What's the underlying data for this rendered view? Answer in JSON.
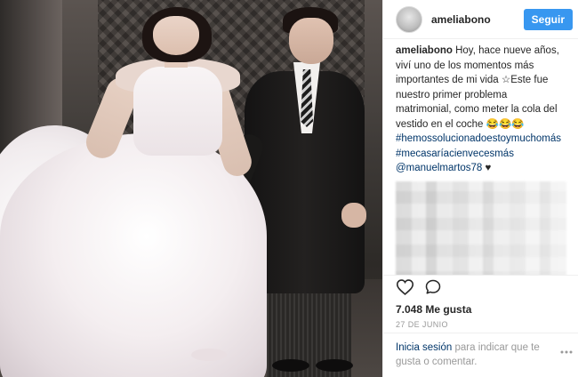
{
  "post": {
    "author": {
      "username": "ameliabono",
      "follow_label": "Seguir"
    },
    "caption": {
      "username": "ameliabono",
      "text": "Hoy, hace nueve años, viví uno de los momentos más importantes de mi vida ☆Este fue nuestro primer problema matrimonial, como meter la cola del vestido en el coche 😂😂😂",
      "hashtags": [
        "#hemossolucionadoestoymuchomás",
        "#mecasaríacienvecesmás"
      ],
      "mention": "@manuelmartos78",
      "mention_suffix": " ♥"
    },
    "actions": {
      "like_icon": "heart-outline-icon",
      "comment_icon": "comment-bubble-icon"
    },
    "likes_text": "7.048 Me gusta",
    "date_text": "27 DE JUNIO",
    "footer": {
      "login_link": "Inicia sesión",
      "login_suffix": " para indicar que te gusta o comentar.",
      "more_icon": "more-options-icon"
    },
    "accent_color": "#3897f0",
    "link_color": "#003569"
  }
}
